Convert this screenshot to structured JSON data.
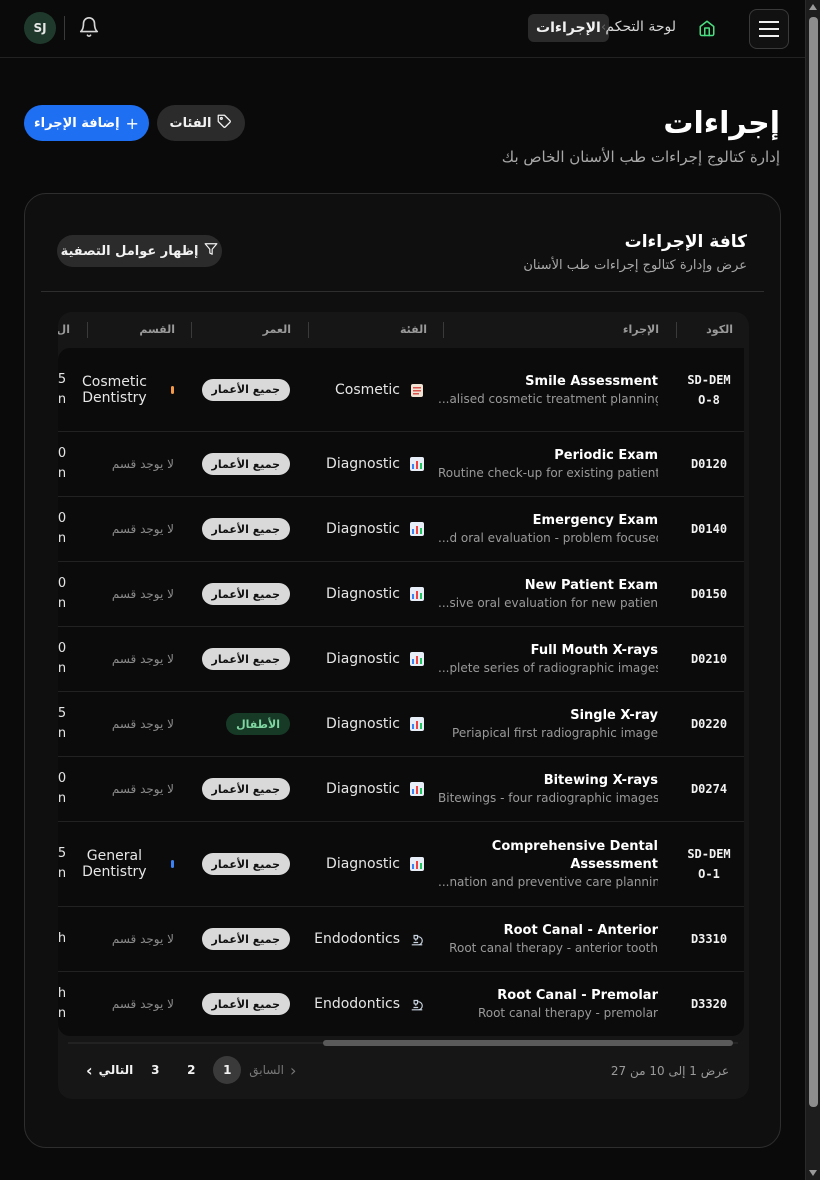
{
  "header": {
    "avatar_initials": "SJ",
    "breadcrumb": {
      "home": "لوحة التحكم",
      "current": "الإجراءات"
    }
  },
  "page": {
    "title": "إجراءات",
    "subtitle": "إدارة كتالوج إجراءات طب الأسنان الخاص بك",
    "add_button": "إضافة الإجراء",
    "categories_button": "الفئات"
  },
  "card": {
    "title": "كافة الإجراءات",
    "subtitle": "عرض وإدارة كتالوج إجراءات طب الأسنان",
    "filter_button": "إظهار عوامل التصفية"
  },
  "table": {
    "columns": {
      "code": "الكود",
      "procedure": "الإجراء",
      "category": "الفئة",
      "age": "العمر",
      "department": "القسم",
      "clipped": "ال"
    },
    "rows": [
      {
        "code": "SD-DEMO-8",
        "name": "Smile Assessment",
        "desc": "...alised cosmetic treatment planning",
        "category": "Cosmetic",
        "age": "جميع الأعمار",
        "department": "Cosmetic Dentistry",
        "clip_top": "5",
        "clip_bottom": "n"
      },
      {
        "code": "D0120",
        "name": "Periodic Exam",
        "desc": "Routine check-up for existing patient",
        "category": "Diagnostic",
        "age": "جميع الأعمار",
        "department": "لا يوجد قسم",
        "clip_top": "0",
        "clip_bottom": "n"
      },
      {
        "code": "D0140",
        "name": "Emergency Exam",
        "desc": "...d oral evaluation - problem focused",
        "category": "Diagnostic",
        "age": "جميع الأعمار",
        "department": "لا يوجد قسم",
        "clip_top": "0",
        "clip_bottom": "n"
      },
      {
        "code": "D0150",
        "name": "New Patient Exam",
        "desc": "...sive oral evaluation for new patient",
        "category": "Diagnostic",
        "age": "جميع الأعمار",
        "department": "لا يوجد قسم",
        "clip_top": "0",
        "clip_bottom": "n"
      },
      {
        "code": "D0210",
        "name": "Full Mouth X-rays",
        "desc": "...plete series of radiographic images",
        "category": "Diagnostic",
        "age": "جميع الأعمار",
        "department": "لا يوجد قسم",
        "clip_top": "0",
        "clip_bottom": "n"
      },
      {
        "code": "D0220",
        "name": "Single X-ray",
        "desc": "Periapical first radiographic image",
        "category": "Diagnostic",
        "age": "الأطفال",
        "department": "لا يوجد قسم",
        "clip_top": "5",
        "clip_bottom": "n"
      },
      {
        "code": "D0274",
        "name": "Bitewing X-rays",
        "desc": "Bitewings - four radiographic images",
        "category": "Diagnostic",
        "age": "جميع الأعمار",
        "department": "لا يوجد قسم",
        "clip_top": "0",
        "clip_bottom": "n"
      },
      {
        "code": "SD-DEMO-1",
        "name": "Comprehensive Dental Assessment",
        "desc": "...nation and preventive care planning",
        "category": "Diagnostic",
        "age": "جميع الأعمار",
        "department": "General Dentistry",
        "clip_top": "5",
        "clip_bottom": "n"
      },
      {
        "code": "D3310",
        "name": "Root Canal - Anterior",
        "desc": "Root canal therapy - anterior tooth",
        "category": "Endodontics",
        "age": "جميع الأعمار",
        "department": "لا يوجد قسم",
        "clip_top": "h",
        "clip_bottom": ""
      },
      {
        "code": "D3320",
        "name": "Root Canal - Premolar",
        "desc": "Root canal therapy - premolar",
        "category": "Endodontics",
        "age": "جميع الأعمار",
        "department": "لا يوجد قسم",
        "clip_top": "h",
        "clip_bottom": "n"
      }
    ]
  },
  "pagination": {
    "info": "عرض 1 إلى 10 من 27",
    "previous": "السابق",
    "next": "التالي",
    "pages": [
      "1",
      "2",
      "3"
    ]
  },
  "colors": {
    "accent": "#1f6ff2",
    "cosmetic_dot": "#f2994a",
    "general_dot": "#3b82f6"
  }
}
